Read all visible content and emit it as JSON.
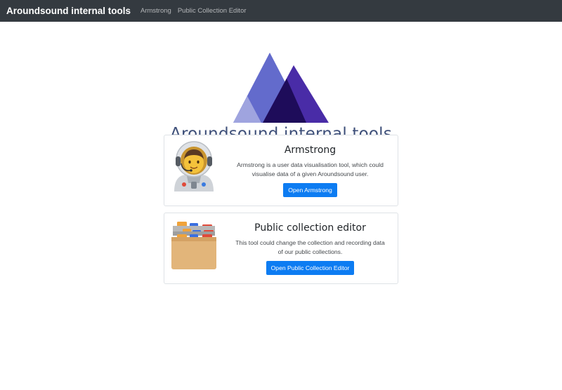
{
  "navbar": {
    "brand": "Aroundsound internal tools",
    "links": [
      "Armstrong",
      "Public Collection Editor"
    ]
  },
  "hero": {
    "title": "Aroundsound internal tools",
    "logo_icon": "triangle-mountains-logo"
  },
  "cards": [
    {
      "icon": "astronaut-icon",
      "title": "Armstrong",
      "text_lines": [
        "Armstrong is a user data visualisation tool, which could",
        "visualise data of a given Aroundsound user."
      ],
      "button": "Open Armstrong"
    },
    {
      "icon": "card-file-box-icon",
      "title": "Public collection editor",
      "text_lines": [
        "This tool could change the collection and recording data",
        "of our public collections."
      ],
      "button": "Open Public Collection Editor"
    }
  ],
  "colors": {
    "navbar_bg": "#343a40",
    "title": "#3d4f79",
    "button": "#0d7cf2",
    "logo_light": "#5b63c9",
    "logo_dark": "#1e0c5a"
  }
}
